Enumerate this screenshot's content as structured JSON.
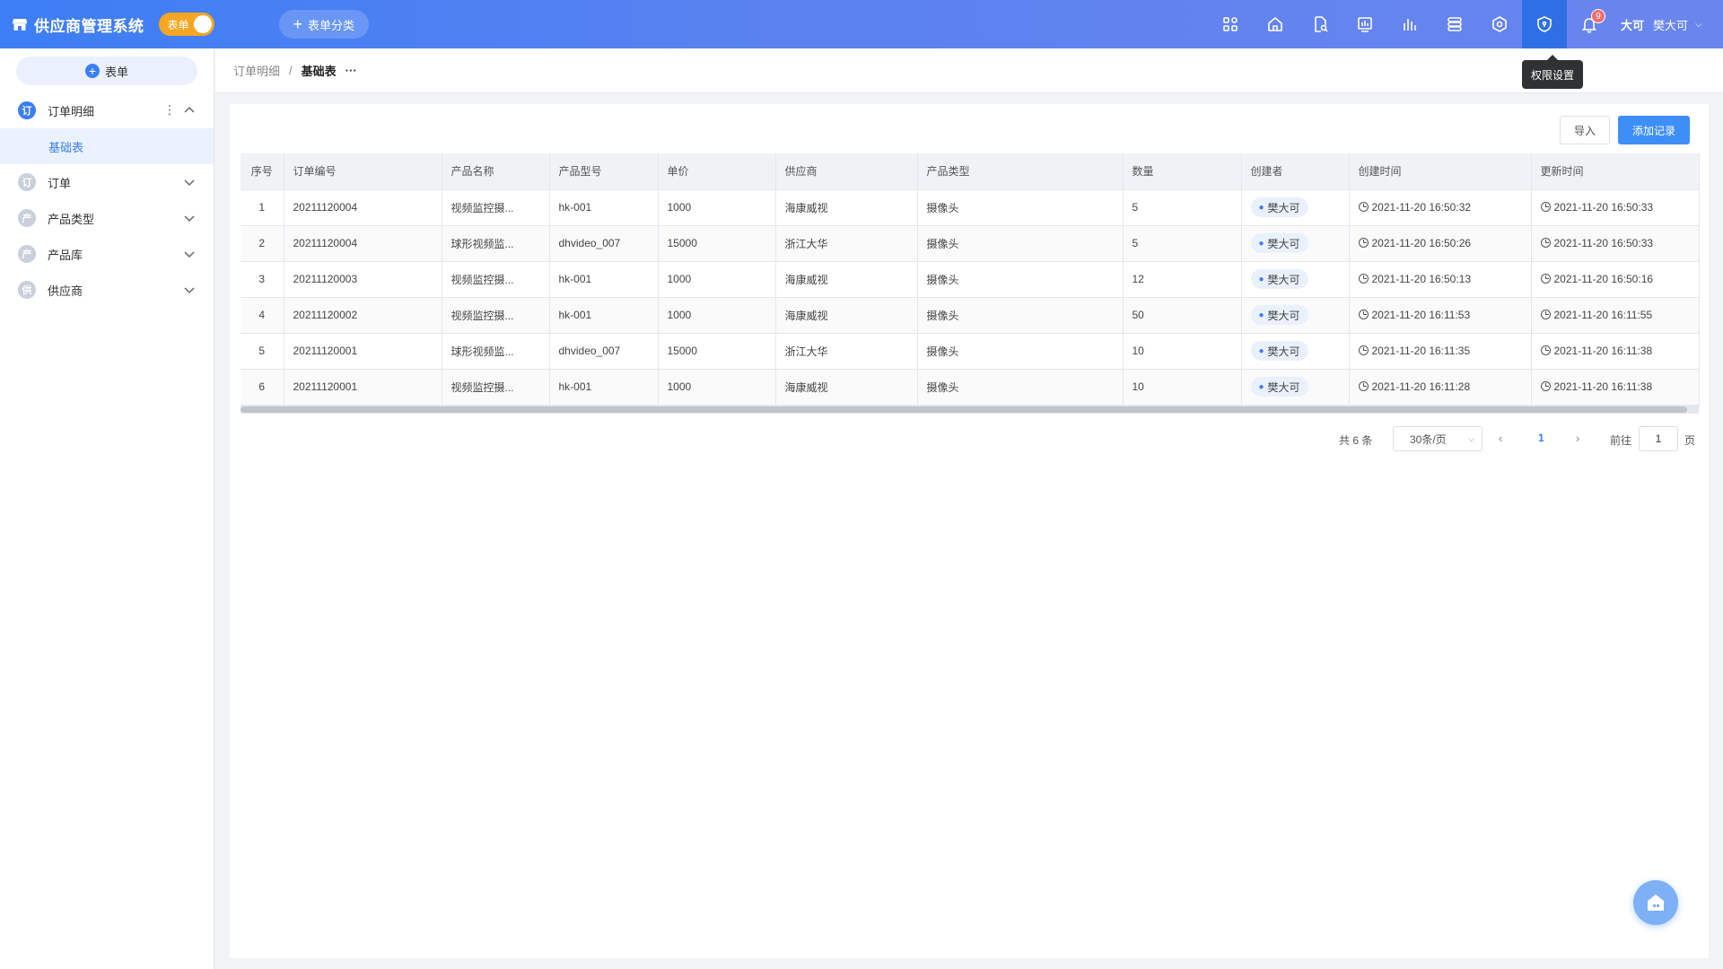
{
  "app": {
    "title": "供应商管理系统",
    "mode_toggle_label": "表单",
    "category_button": "表单分类"
  },
  "topbar": {
    "icons": [
      "apps-icon",
      "home-icon",
      "file-search-icon",
      "dashboard-icon",
      "chart-icon",
      "database-icon",
      "settings-icon",
      "shield-icon",
      "bell-icon"
    ],
    "notification_count": "9",
    "active_tooltip": "权限设置",
    "user_avatar": "大可",
    "user_name": "樊大可"
  },
  "sidebar": {
    "new_form_label": "表单",
    "items": [
      {
        "icon_text": "订",
        "label": "订单明细",
        "expanded": true,
        "children": [
          "基础表"
        ]
      },
      {
        "icon_text": "订",
        "label": "订单"
      },
      {
        "icon_text": "产",
        "label": "产品类型"
      },
      {
        "icon_text": "产",
        "label": "产品库"
      },
      {
        "icon_text": "供",
        "label": "供应商"
      }
    ]
  },
  "breadcrumb": {
    "parent": "订单明细",
    "separator": "/",
    "current": "基础表",
    "more": "···"
  },
  "toolbar": {
    "import_label": "导入",
    "add_label": "添加记录"
  },
  "table": {
    "columns": [
      "序号",
      "订单编号",
      "产品名称",
      "产品型号",
      "单价",
      "供应商",
      "产品类型",
      "数量",
      "创建者",
      "创建时间",
      "更新时间"
    ],
    "rows": [
      [
        "1",
        "20211120004",
        "视频监控摄...",
        "hk-001",
        "1000",
        "海康威视",
        "摄像头",
        "5",
        "樊大可",
        "2021-11-20 16:50:32",
        "2021-11-20 16:50:33"
      ],
      [
        "2",
        "20211120004",
        "球形视频监...",
        "dhvideo_007",
        "15000",
        "浙江大华",
        "摄像头",
        "5",
        "樊大可",
        "2021-11-20 16:50:26",
        "2021-11-20 16:50:33"
      ],
      [
        "3",
        "20211120003",
        "视频监控摄...",
        "hk-001",
        "1000",
        "海康威视",
        "摄像头",
        "12",
        "樊大可",
        "2021-11-20 16:50:13",
        "2021-11-20 16:50:16"
      ],
      [
        "4",
        "20211120002",
        "视频监控摄...",
        "hk-001",
        "1000",
        "海康威视",
        "摄像头",
        "50",
        "樊大可",
        "2021-11-20 16:11:53",
        "2021-11-20 16:11:55"
      ],
      [
        "5",
        "20211120001",
        "球形视频监...",
        "dhvideo_007",
        "15000",
        "浙江大华",
        "摄像头",
        "10",
        "樊大可",
        "2021-11-20 16:11:35",
        "2021-11-20 16:11:38"
      ],
      [
        "6",
        "20211120001",
        "视频监控摄...",
        "hk-001",
        "1000",
        "海康威视",
        "摄像头",
        "10",
        "樊大可",
        "2021-11-20 16:11:28",
        "2021-11-20 16:11:38"
      ]
    ]
  },
  "pagination": {
    "total": "共 6 条",
    "page_size": "30条/页",
    "current_page": "1",
    "goto_label": "前往",
    "goto_value": "1",
    "page_suffix": "页"
  },
  "colors": {
    "primary": "#3d7ef5",
    "topbar_gradient_end": "#6a85ee",
    "toggle": "#f6a623",
    "badge": "#f56c6c"
  }
}
